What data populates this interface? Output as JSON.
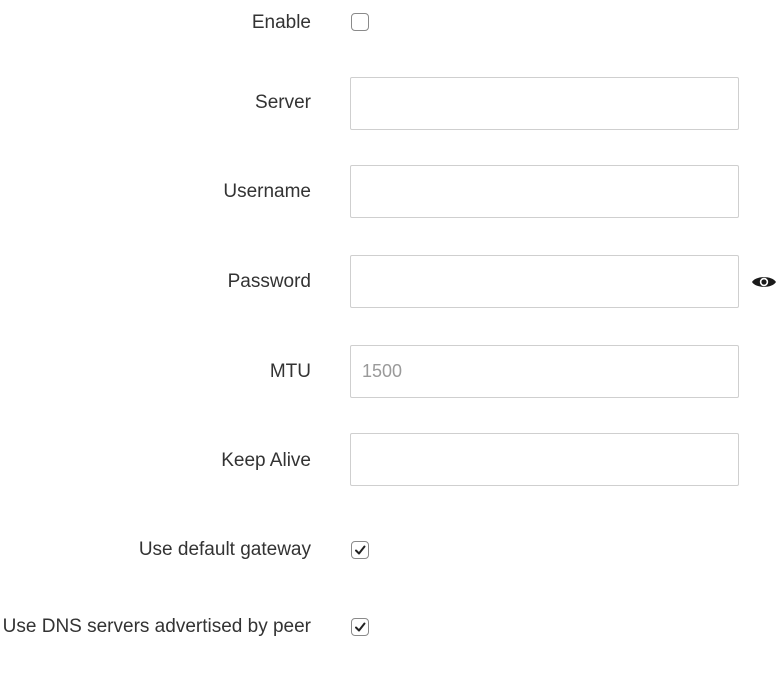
{
  "form": {
    "enable": {
      "label": "Enable",
      "checked": false
    },
    "server": {
      "label": "Server",
      "value": "",
      "placeholder": ""
    },
    "username": {
      "label": "Username",
      "value": "",
      "placeholder": ""
    },
    "password": {
      "label": "Password",
      "value": "",
      "placeholder": "",
      "toggle_icon": "eye-icon"
    },
    "mtu": {
      "label": "MTU",
      "value": "",
      "placeholder": "1500"
    },
    "keep_alive": {
      "label": "Keep Alive",
      "value": "",
      "placeholder": ""
    },
    "use_default_gateway": {
      "label": "Use default gateway",
      "checked": true
    },
    "use_dns_servers": {
      "label": "Use DNS servers advertised by peer",
      "checked": true
    }
  },
  "colors": {
    "text": "#333333",
    "border": "#cfcfcf",
    "placeholder": "#9a9a9a"
  }
}
